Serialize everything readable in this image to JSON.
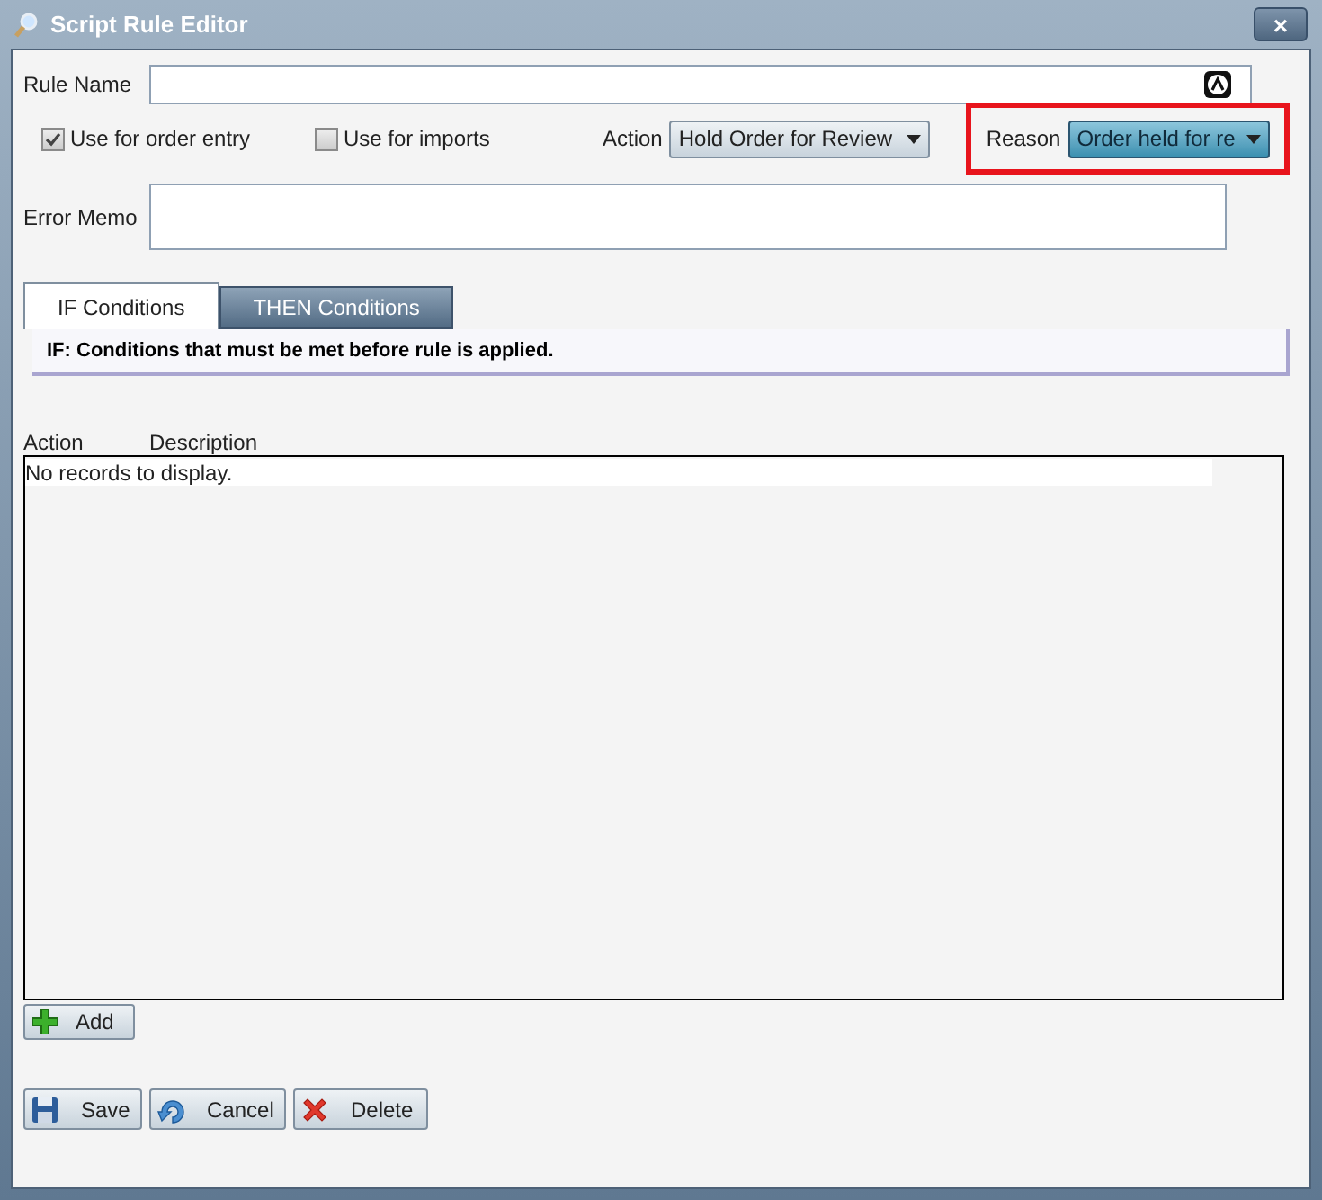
{
  "window": {
    "title": "Script Rule Editor",
    "close": "×"
  },
  "rule_name": {
    "label": "Rule Name"
  },
  "options": [
    {
      "label": "Use for order entry",
      "checked": true
    },
    {
      "label": "Use for imports",
      "checked": false
    }
  ],
  "action": {
    "label": "Action",
    "value": "Hold Order for Review"
  },
  "reason": {
    "label": "Reason",
    "value": "Order held for re",
    "highlighted": true
  },
  "error_memo": {
    "label": "Error Memo"
  },
  "tabs": [
    {
      "label": "IF Conditions",
      "selected": true
    },
    {
      "label": "THEN Conditions",
      "selected": false
    }
  ],
  "info": "IF: Conditions that must be met before rule is applied.",
  "table": {
    "columns": [
      "Action",
      "Description"
    ],
    "empty_text": "No records to display."
  },
  "add_button": "Add",
  "buttons": [
    {
      "kind": "save",
      "label": "Save"
    },
    {
      "kind": "cancel",
      "label": "Cancel"
    },
    {
      "kind": "delete",
      "label": "Delete"
    }
  ]
}
